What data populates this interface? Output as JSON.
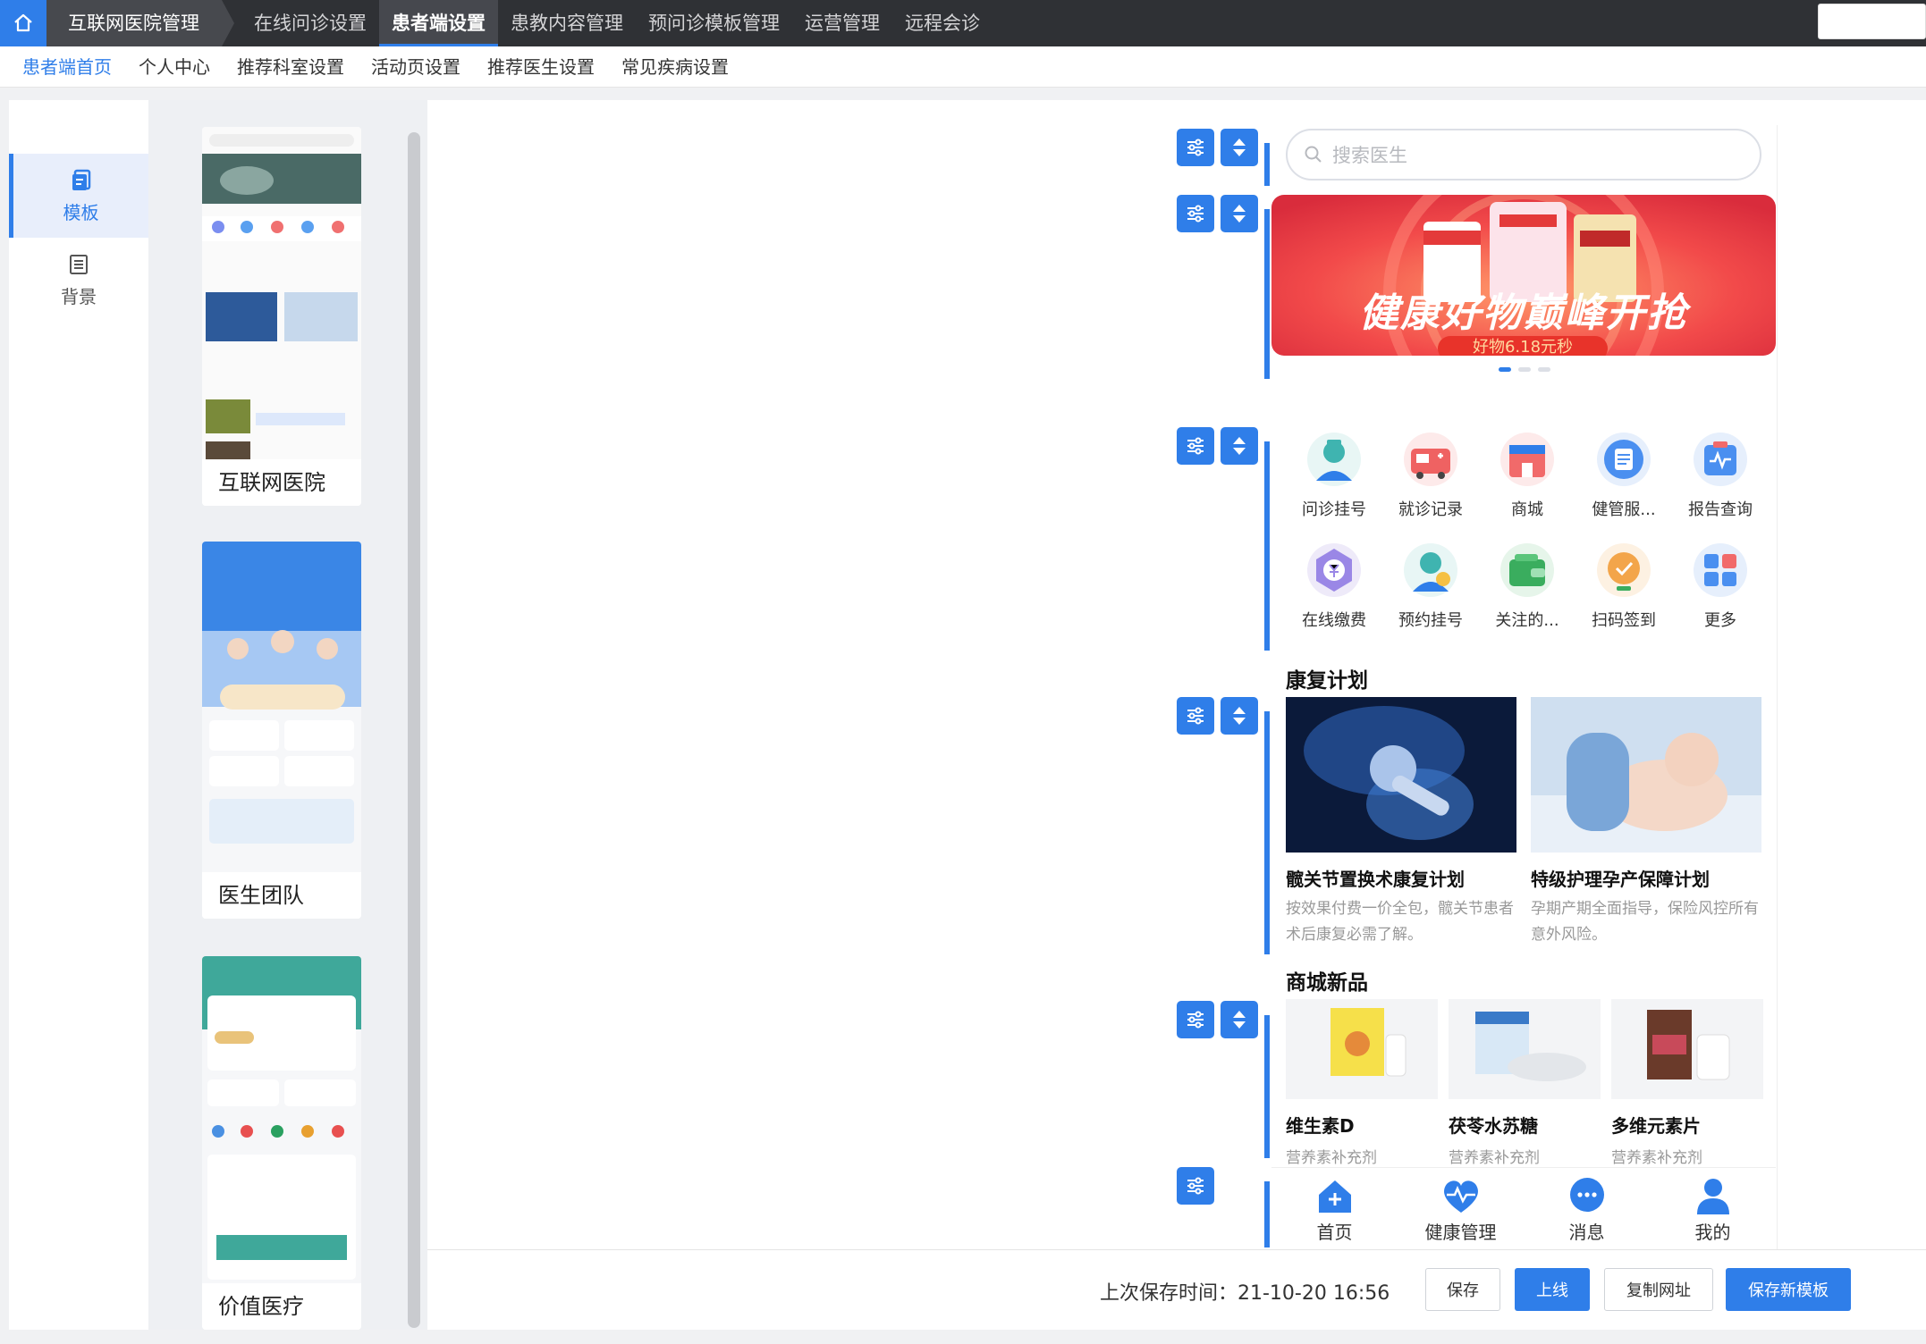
{
  "topnav": {
    "app_title": "互联网医院管理",
    "tabs": [
      "在线问诊设置",
      "患者端设置",
      "患教内容管理",
      "预问诊模板管理",
      "运营管理",
      "远程会诊"
    ]
  },
  "subnav": {
    "items": [
      "患者端首页",
      "个人中心",
      "推荐科室设置",
      "活动页设置",
      "推荐医生设置",
      "常见疾病设置"
    ]
  },
  "left_tabs": [
    {
      "label": "模板"
    },
    {
      "label": "背景"
    }
  ],
  "templates": [
    {
      "label": "互联网医院"
    },
    {
      "label": "医生团队"
    },
    {
      "label": "价值医疗"
    }
  ],
  "phone": {
    "search_placeholder": "搜索医生",
    "banner": {
      "headline": "健康好物巅峰开抢",
      "sub": "好物6.18元秒"
    },
    "icons": [
      {
        "label": "问诊挂号",
        "icon": "doctor-icon"
      },
      {
        "label": "就诊记录",
        "icon": "ambulance-icon"
      },
      {
        "label": "商城",
        "icon": "store-icon"
      },
      {
        "label": "健管服...",
        "icon": "clipboard-icon"
      },
      {
        "label": "报告查询",
        "icon": "report-icon"
      },
      {
        "label": "在线缴费",
        "icon": "payment-icon"
      },
      {
        "label": "预约挂号",
        "icon": "appointment-icon"
      },
      {
        "label": "关注的...",
        "icon": "wallet-icon"
      },
      {
        "label": "扫码签到",
        "icon": "checkin-icon"
      },
      {
        "label": "更多",
        "icon": "grid-icon"
      }
    ],
    "rehab": {
      "title": "康复计划",
      "items": [
        {
          "title": "髋关节置换术康复计划",
          "desc": "按效果付费一价全包，髋关节患者术后康复必需了解。"
        },
        {
          "title": "特级护理孕产保障计划",
          "desc": "孕期产期全面指导，保险风控所有意外风险。"
        }
      ]
    },
    "products": {
      "title": "商城新品",
      "items": [
        {
          "title": "维生素D",
          "desc": "营养素补充剂"
        },
        {
          "title": "茯苓水苏糖",
          "desc": "营养素补充剂"
        },
        {
          "title": "多维元素片",
          "desc": "营养素补充剂"
        }
      ]
    },
    "tabbar": [
      {
        "label": "首页",
        "icon": "home-icon"
      },
      {
        "label": "健康管理",
        "icon": "heart-pulse-icon"
      },
      {
        "label": "消息",
        "icon": "message-icon"
      },
      {
        "label": "我的",
        "icon": "user-icon"
      }
    ]
  },
  "footer": {
    "save_time": "上次保存时间：21-10-20 16:56",
    "buttons": [
      "保存",
      "上线",
      "复制网址",
      "保存新模板"
    ]
  },
  "colors": {
    "accent": "#2f7ee9",
    "topbar": "#2f3135"
  }
}
